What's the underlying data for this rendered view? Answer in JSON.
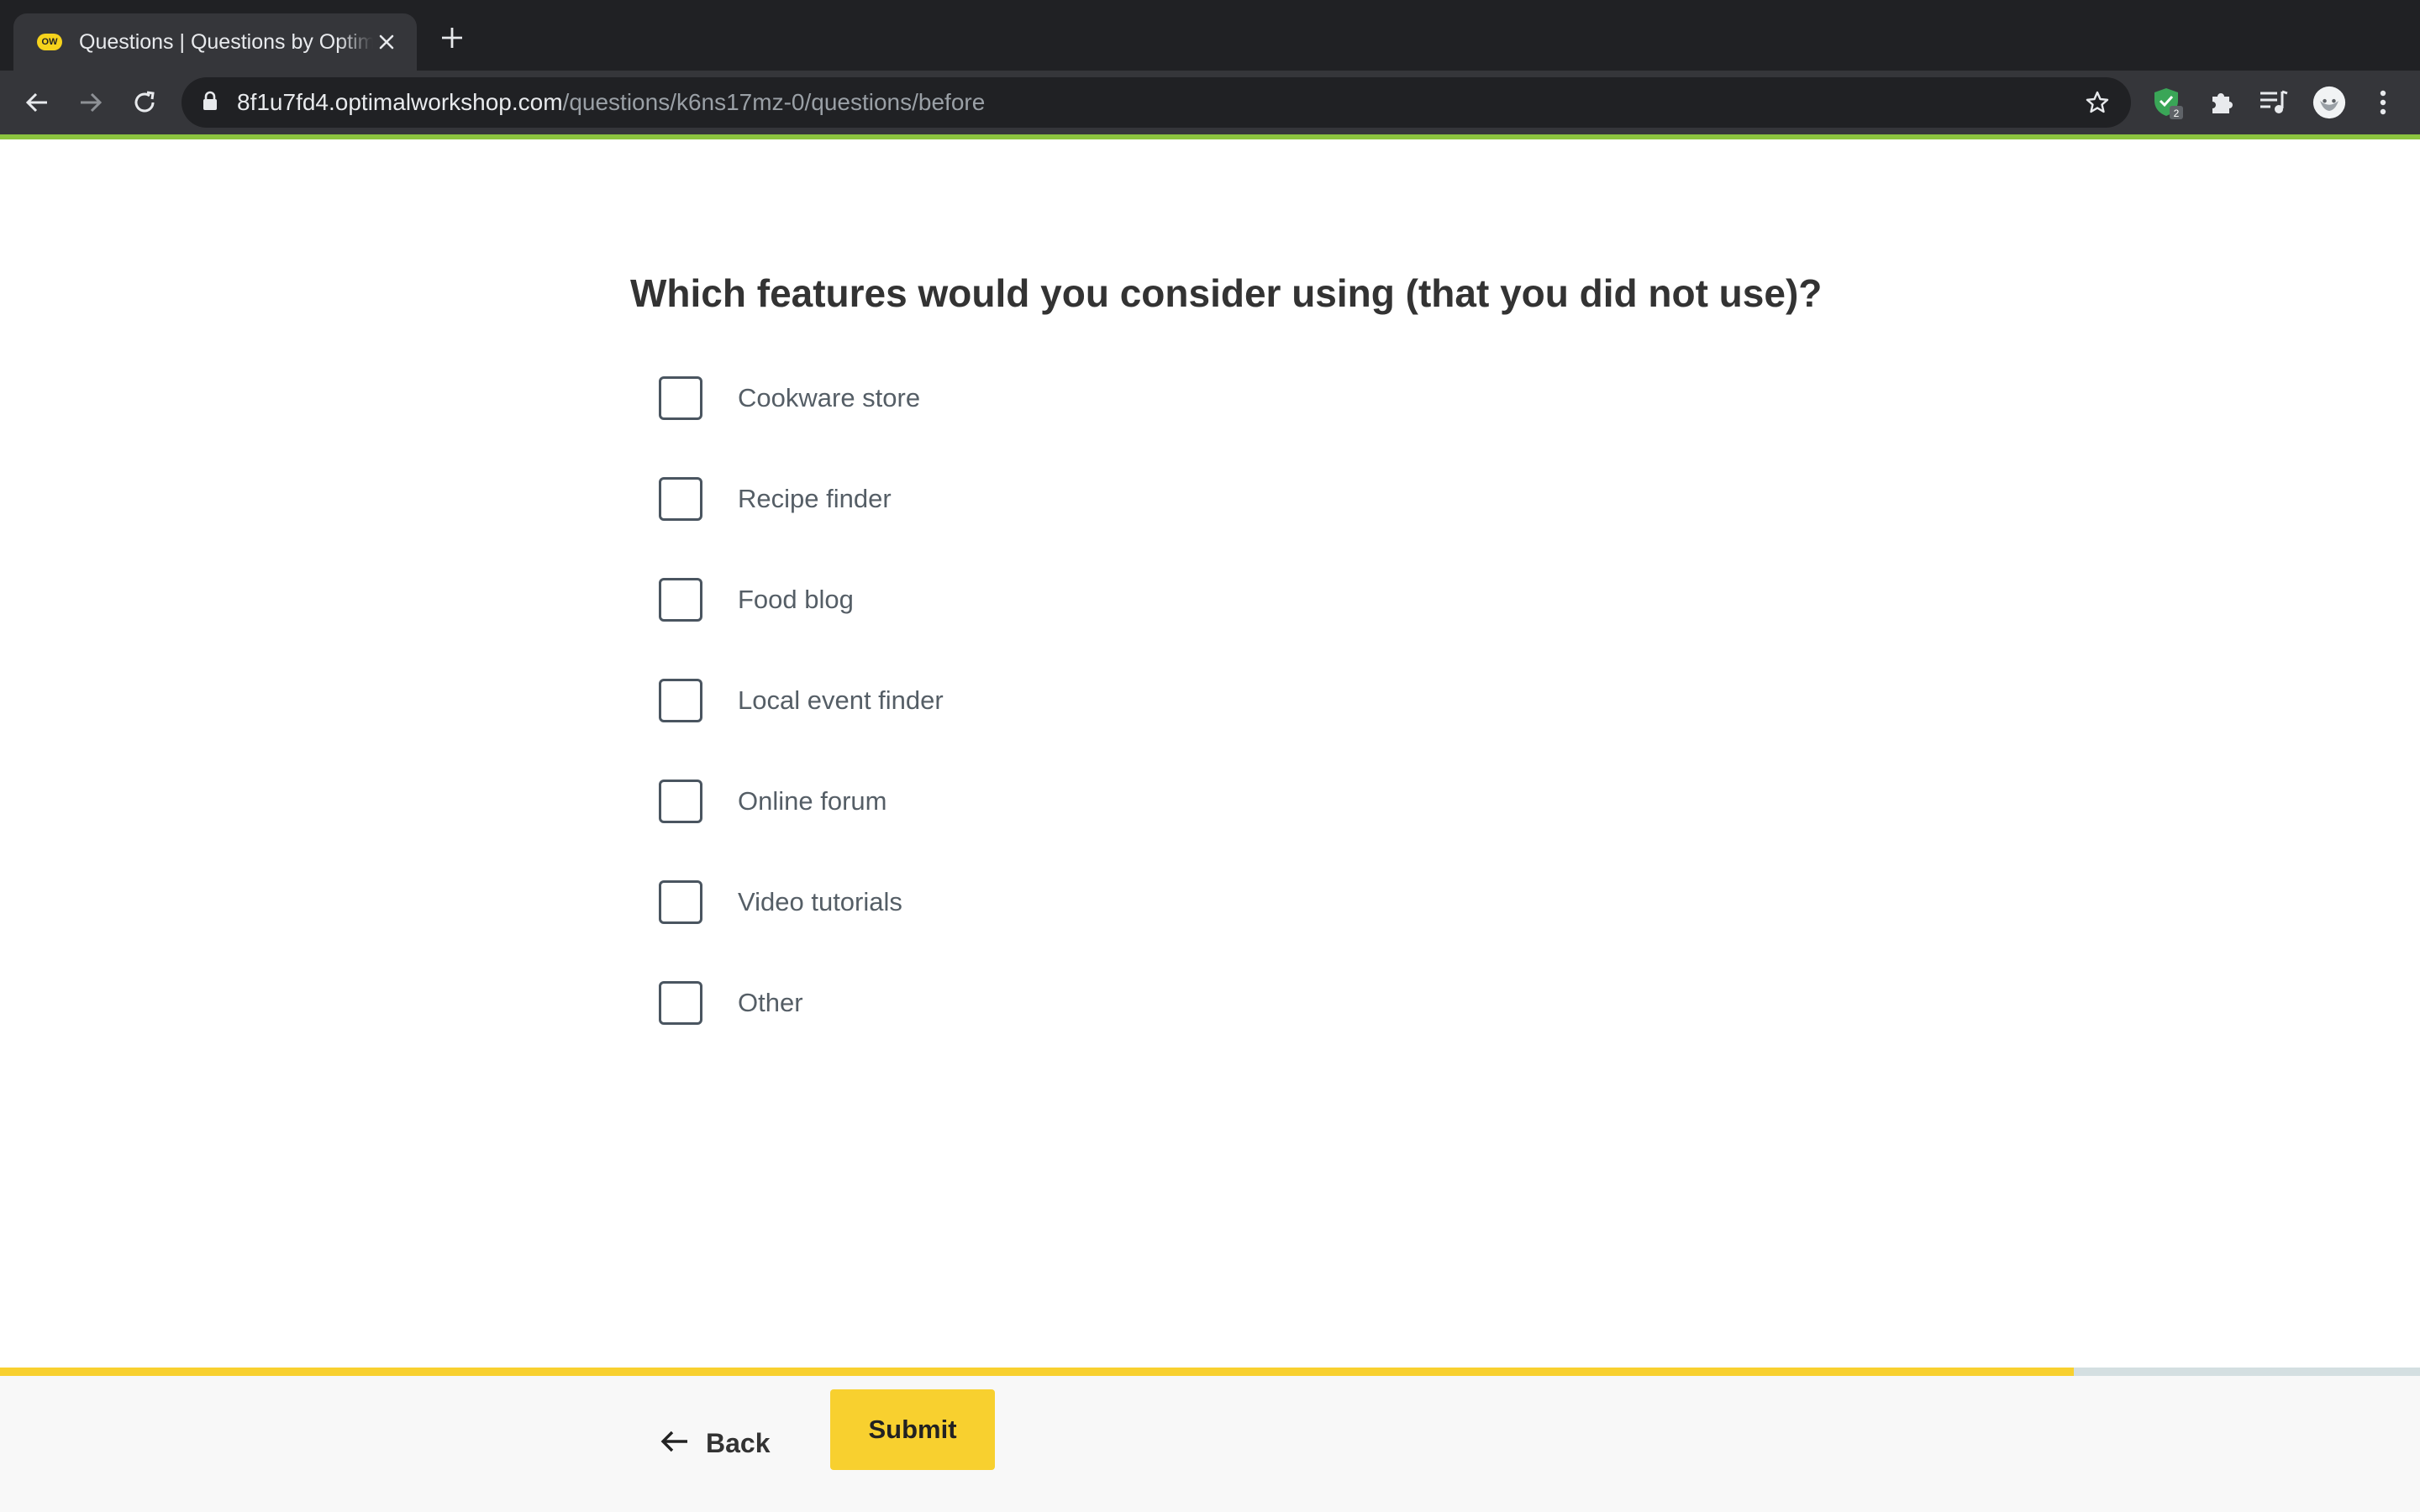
{
  "browser": {
    "tab": {
      "favicon_text": "OW",
      "title": "Questions | Questions by Optimal Workshop"
    },
    "url": {
      "host": "8f1u7fd4.optimalworkshop.com",
      "path": "/questions/k6ns17mz-0/questions/before"
    },
    "extension_badge": "2",
    "accent_color": "#8cc43f"
  },
  "question": {
    "title": "Which features would you consider using (that you did not use)?",
    "options": [
      {
        "label": "Cookware store",
        "checked": false
      },
      {
        "label": "Recipe finder",
        "checked": false
      },
      {
        "label": "Food blog",
        "checked": false
      },
      {
        "label": "Local event finder",
        "checked": false
      },
      {
        "label": "Online forum",
        "checked": false
      },
      {
        "label": "Video tutorials",
        "checked": false
      },
      {
        "label": "Other",
        "checked": false
      }
    ]
  },
  "progress": {
    "fraction": 0.857,
    "fill_color": "#f8d02f",
    "track_color": "#d4dfe1"
  },
  "footer": {
    "back_label": "Back",
    "submit_label": "Submit"
  }
}
